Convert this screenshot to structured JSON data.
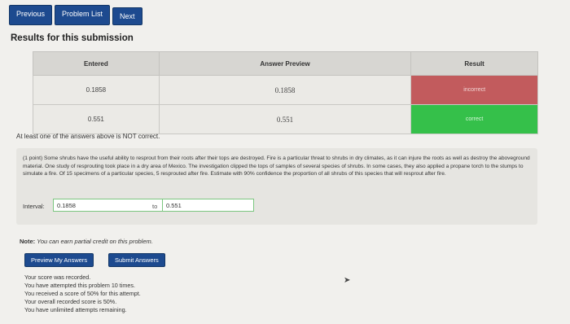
{
  "nav": {
    "previous": "Previous",
    "problem_list": "Problem List",
    "next": "Next"
  },
  "results_title": "Results for this submission",
  "table": {
    "headers": {
      "entered": "Entered",
      "preview": "Answer Preview",
      "result": "Result"
    },
    "rows": [
      {
        "entered": "0.1858",
        "preview": "0.1858",
        "result": "incorrect"
      },
      {
        "entered": "0.551",
        "preview": "0.551",
        "result": "correct"
      }
    ]
  },
  "warning": "At least one of the answers above is NOT correct.",
  "problem": {
    "text": "(1 point) Some shrubs have the useful ability to resprout from their roots after their tops are destroyed. Fire is a particular threat to shrubs in dry climates, as it can injure the roots as well as destroy the aboveground material. One study of resprouting took place in a dry area of Mexico. The investigation clipped the tops of samples of several species of shrubs. In some cases, they also applied a propane torch to the stumps to simulate a fire. Of 15 specimens of a particular species, 5 resprouted after fire. Estimate with 90% confidence the proportion of all shrubs of this species that will resprout after fire.",
    "interval_label": "Interval:",
    "lower_value": "0.1858",
    "to_label": "to",
    "upper_value": "0.551"
  },
  "note": {
    "prefix": "Note:",
    "text": "You can earn partial credit on this problem."
  },
  "buttons": {
    "preview": "Preview My Answers",
    "submit": "Submit Answers"
  },
  "score_lines": [
    "Your score was recorded.",
    "You have attempted this problem 10 times.",
    "You received a score of 50% for this attempt.",
    "Your overall recorded score is 50%.",
    "You have unlimited attempts remaining."
  ],
  "colors": {
    "incorrect": "#c25b5d",
    "correct": "#35c04a",
    "button": "#1d4a8f"
  }
}
